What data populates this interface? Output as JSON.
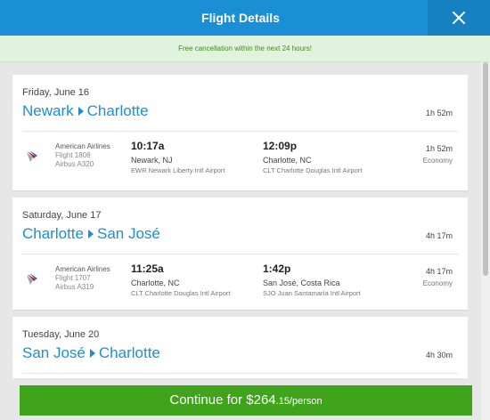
{
  "header": {
    "title": "Flight Details",
    "close_icon": "close-icon"
  },
  "banner": {
    "text": "Free cancellation within the next 24 hours!"
  },
  "legs": [
    {
      "date": "Friday, June 16",
      "origin": "Newark",
      "destination": "Charlotte",
      "total_duration": "1h 52m",
      "segment": {
        "airline": "American Airlines",
        "flight": "Flight 1808",
        "aircraft": "Airbus A320",
        "dep_time": "10:17a",
        "dep_city": "Newark, NJ",
        "dep_airport": "EWR Newark Liberty Intl Airport",
        "arr_time": "12:09p",
        "arr_city": "Charlotte, NC",
        "arr_airport": "CLT Charlotte Douglas Intl Airport",
        "duration": "1h 52m",
        "cabin": "Economy"
      }
    },
    {
      "date": "Saturday, June 17",
      "origin": "Charlotte",
      "destination": "San José",
      "total_duration": "4h 17m",
      "segment": {
        "airline": "American Airlines",
        "flight": "Flight 1707",
        "aircraft": "Airbus A319",
        "dep_time": "11:25a",
        "dep_city": "Charlotte, NC",
        "dep_airport": "CLT Charlotte Douglas Intl Airport",
        "arr_time": "1:42p",
        "arr_city": "San José, Costa Rica",
        "arr_airport": "SJO Juan Santamaría Intl Airport",
        "duration": "4h 17m",
        "cabin": "Economy"
      }
    },
    {
      "date": "Tuesday, June 20",
      "origin": "San José",
      "destination": "Charlotte",
      "total_duration": "4h 30m"
    }
  ],
  "footer": {
    "continue_label": "Continue for $264",
    "continue_cents": ".15/person"
  },
  "colors": {
    "accent": "#1a8fd5",
    "continue": "#3fa41c",
    "banner_text": "#3f8b1c"
  }
}
